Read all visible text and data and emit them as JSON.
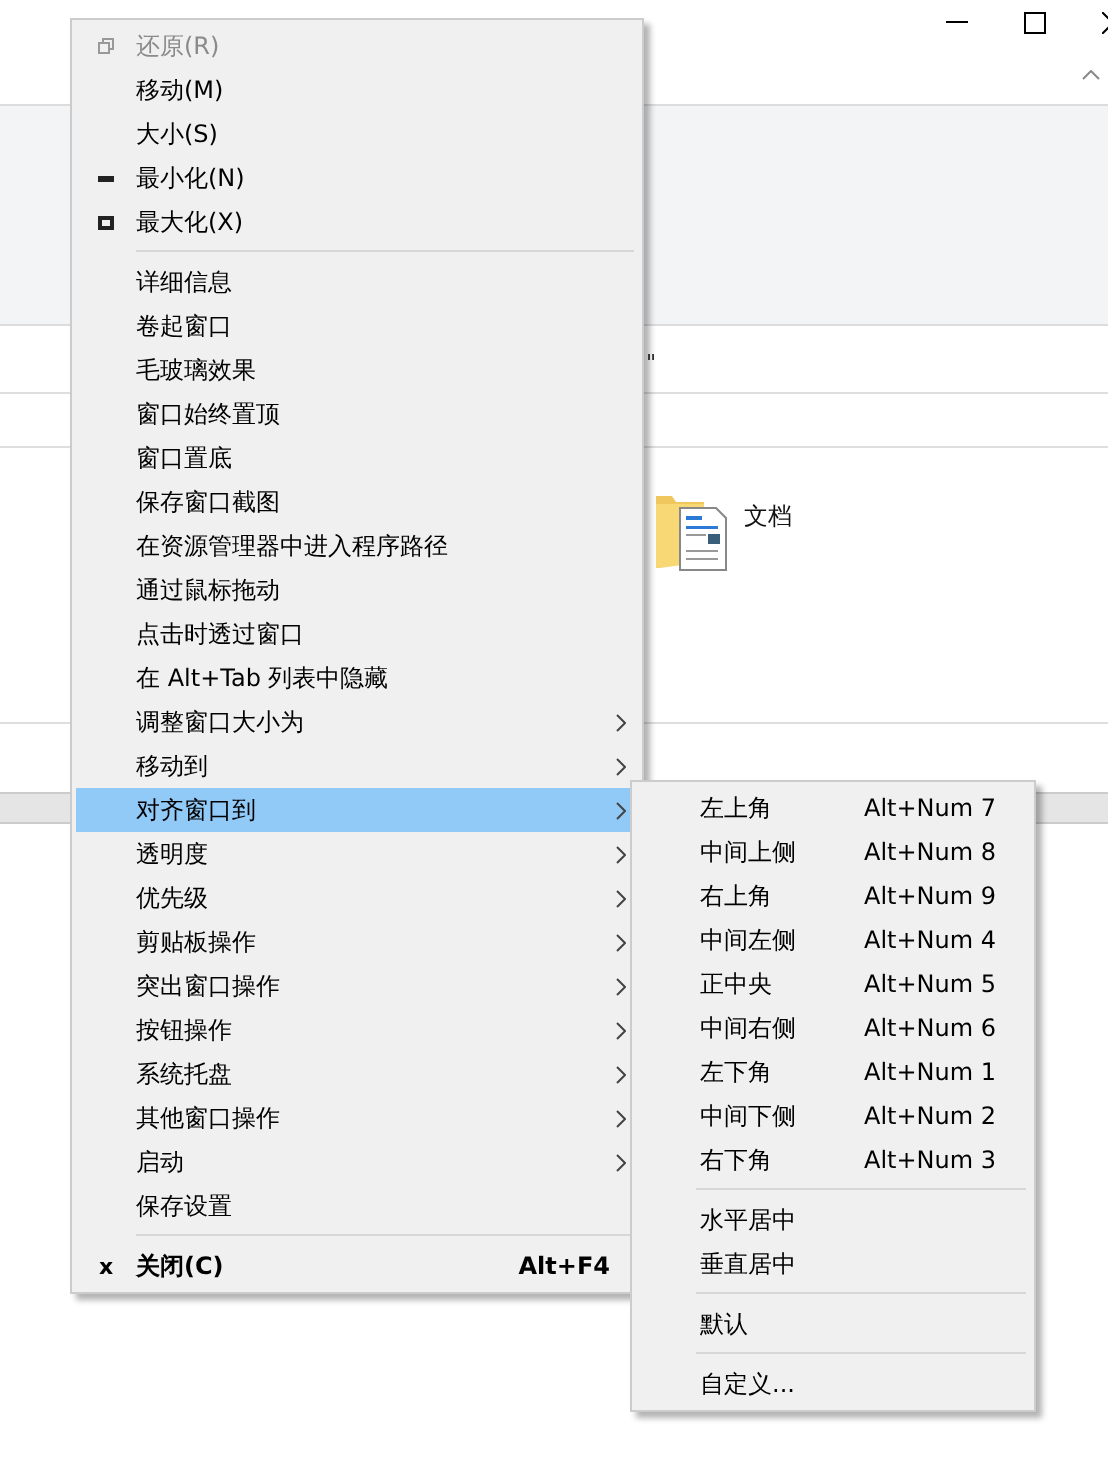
{
  "background_window": {
    "address_fragment": "\"",
    "folder": {
      "name": "文档"
    }
  },
  "menu": {
    "items": [
      {
        "kind": "restore",
        "label": "还原(R)",
        "disabled": true,
        "selected": false
      },
      {
        "kind": "item",
        "label": "移动(M)",
        "disabled": false,
        "selected": false
      },
      {
        "kind": "item",
        "label": "大小(S)",
        "disabled": false,
        "selected": false
      },
      {
        "kind": "minimize",
        "label": "最小化(N)",
        "disabled": false,
        "selected": false
      },
      {
        "kind": "maximize",
        "label": "最大化(X)",
        "disabled": false,
        "selected": false
      },
      {
        "kind": "separator"
      },
      {
        "kind": "item",
        "label": "详细信息",
        "disabled": false,
        "selected": false
      },
      {
        "kind": "item",
        "label": "卷起窗口",
        "disabled": false,
        "selected": false
      },
      {
        "kind": "item",
        "label": "毛玻璃效果",
        "disabled": false,
        "selected": false
      },
      {
        "kind": "item",
        "label": "窗口始终置顶",
        "disabled": false,
        "selected": false
      },
      {
        "kind": "item",
        "label": "窗口置底",
        "disabled": false,
        "selected": false
      },
      {
        "kind": "item",
        "label": "保存窗口截图",
        "disabled": false,
        "selected": false
      },
      {
        "kind": "item",
        "label": "在资源管理器中进入程序路径",
        "disabled": false,
        "selected": false
      },
      {
        "kind": "item",
        "label": "通过鼠标拖动",
        "disabled": false,
        "selected": false
      },
      {
        "kind": "item",
        "label": "点击时透过窗口",
        "disabled": false,
        "selected": false
      },
      {
        "kind": "item",
        "label": "在 Alt+Tab 列表中隐藏",
        "disabled": false,
        "selected": false
      },
      {
        "kind": "submenu",
        "label": "调整窗口大小为",
        "disabled": false,
        "selected": false
      },
      {
        "kind": "submenu",
        "label": "移动到",
        "disabled": false,
        "selected": false
      },
      {
        "kind": "submenu",
        "label": "对齐窗口到",
        "disabled": false,
        "selected": true
      },
      {
        "kind": "submenu",
        "label": "透明度",
        "disabled": false,
        "selected": false
      },
      {
        "kind": "submenu",
        "label": "优先级",
        "disabled": false,
        "selected": false
      },
      {
        "kind": "submenu",
        "label": "剪贴板操作",
        "disabled": false,
        "selected": false
      },
      {
        "kind": "submenu",
        "label": "突出窗口操作",
        "disabled": false,
        "selected": false
      },
      {
        "kind": "submenu",
        "label": "按钮操作",
        "disabled": false,
        "selected": false
      },
      {
        "kind": "submenu",
        "label": "系统托盘",
        "disabled": false,
        "selected": false
      },
      {
        "kind": "submenu",
        "label": "其他窗口操作",
        "disabled": false,
        "selected": false
      },
      {
        "kind": "submenu",
        "label": "启动",
        "disabled": false,
        "selected": false
      },
      {
        "kind": "item",
        "label": "保存设置",
        "disabled": false,
        "selected": false
      },
      {
        "kind": "separator"
      },
      {
        "kind": "close",
        "label": "关闭(C)",
        "icon_text": "x",
        "shortcut": "Alt+F4",
        "bold": true,
        "disabled": false,
        "selected": false
      }
    ]
  },
  "submenu": {
    "items": [
      {
        "kind": "item",
        "label": "左上角",
        "shortcut": "Alt+Num 7"
      },
      {
        "kind": "item",
        "label": "中间上侧",
        "shortcut": "Alt+Num 8"
      },
      {
        "kind": "item",
        "label": "右上角",
        "shortcut": "Alt+Num 9"
      },
      {
        "kind": "item",
        "label": "中间左侧",
        "shortcut": "Alt+Num 4"
      },
      {
        "kind": "item",
        "label": "正中央",
        "shortcut": "Alt+Num 5"
      },
      {
        "kind": "item",
        "label": "中间右侧",
        "shortcut": "Alt+Num 6"
      },
      {
        "kind": "item",
        "label": "左下角",
        "shortcut": "Alt+Num 1"
      },
      {
        "kind": "item",
        "label": "中间下侧",
        "shortcut": "Alt+Num 2"
      },
      {
        "kind": "item",
        "label": "右下角",
        "shortcut": "Alt+Num 3"
      },
      {
        "kind": "separator"
      },
      {
        "kind": "item",
        "label": "水平居中"
      },
      {
        "kind": "item",
        "label": "垂直居中"
      },
      {
        "kind": "separator"
      },
      {
        "kind": "item",
        "label": "默认"
      },
      {
        "kind": "separator"
      },
      {
        "kind": "item",
        "label": "自定义..."
      }
    ]
  }
}
